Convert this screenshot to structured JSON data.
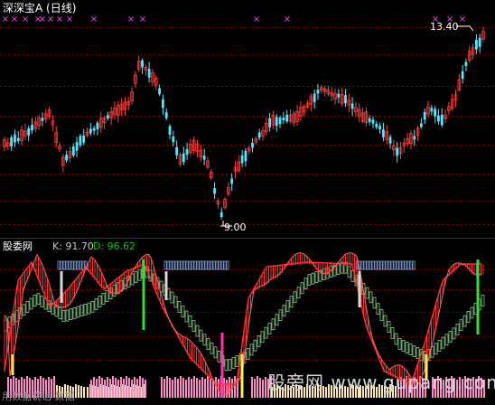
{
  "header": {
    "title": "深深宝A (日线)",
    "price_high_label": "13.40",
    "price_low_label": "9.00"
  },
  "indicator": {
    "name": "股委网",
    "k_text": "K: 91.70",
    "d_text": "D: 96.62",
    "k_value": 91.7,
    "d_value": 96.62
  },
  "watermarks": {
    "left": "用数据说话 数据",
    "right": "股旁网 www.gupang.com"
  },
  "colors": {
    "background": "#000000",
    "grid": "#8b0000",
    "separator": "#b00000",
    "up_candle": "#ff3b3b",
    "down_candle": "#55e6ff",
    "signal_marker": "#ff44ff",
    "k_line": "#ff3030",
    "d_line": "#9be69b",
    "blue_block": "#7f9fdc",
    "white_signal": "#d8d8d8",
    "green_signal": "#33dd33",
    "magenta_signal": "#ff33aa",
    "yellow_signal": "#ffee55",
    "pink_bars": "#ff88c8",
    "cream_bars": "#ffe7b0"
  }
}
